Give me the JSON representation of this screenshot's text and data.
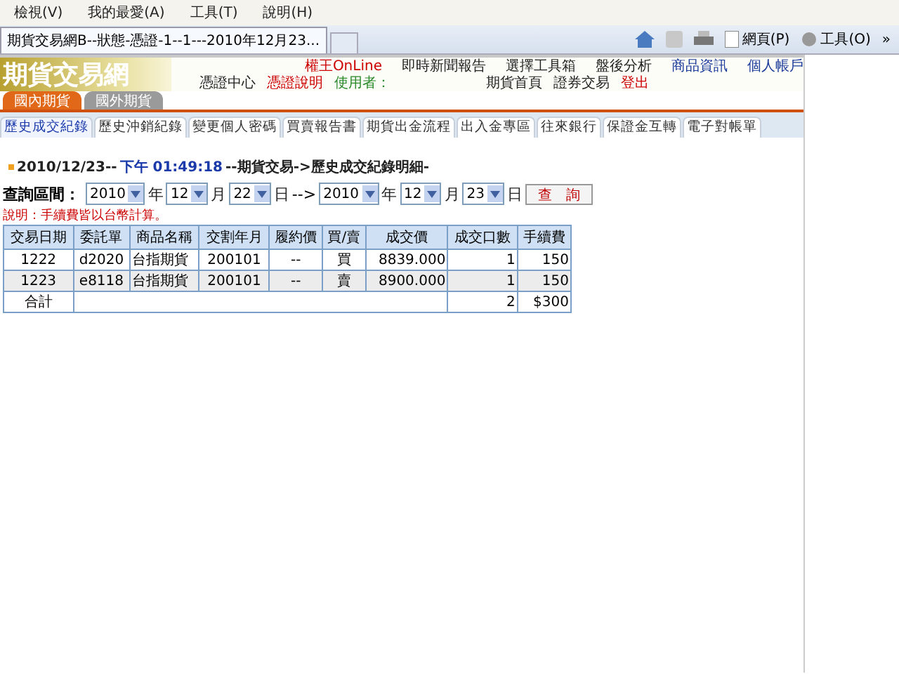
{
  "menu_bar": [
    "檢視(V)",
    "我的最愛(A)",
    "工具(T)",
    "說明(H)"
  ],
  "browser_tab": {
    "title": "期貨交易網B--狀態-憑證-1--1---2010年12月23..."
  },
  "toolbar": [
    {
      "kind": "home"
    },
    {
      "kind": "feed"
    },
    {
      "kind": "print"
    },
    {
      "kind": "page",
      "label": "網頁(P)"
    },
    {
      "kind": "tools",
      "label": "工具(O)"
    },
    {
      "kind": "more",
      "label": "»"
    }
  ],
  "site": {
    "logo": "期貨交易網",
    "nav_top": [
      {
        "label": "權王OnLine",
        "color": "#cc0000"
      },
      {
        "label": "即時新聞報告",
        "color": "#222222"
      },
      {
        "label": "選擇工具箱",
        "color": "#222222"
      },
      {
        "label": "盤後分析",
        "color": "#222222"
      },
      {
        "label": "商品資訊",
        "color": "#1a3a9a"
      },
      {
        "label": "個人帳戶",
        "color": "#1a3a9a"
      }
    ],
    "nav_bottom": [
      {
        "label": "憑證中心",
        "color": "#222222"
      },
      {
        "label": "憑證說明",
        "color": "#cc0000"
      },
      {
        "label": "使用者：",
        "color": "#2a8a2a"
      },
      {
        "label": "期貨首頁",
        "color": "#222222"
      },
      {
        "label": "證券交易",
        "color": "#222222"
      },
      {
        "label": "登出",
        "color": "#cc0000"
      }
    ]
  },
  "market_tabs": [
    {
      "label": "國內期貨",
      "selected": true
    },
    {
      "label": "國外期貨",
      "selected": false
    }
  ],
  "sub_tabs": [
    {
      "label": "歷史成交紀錄",
      "selected": true
    },
    {
      "label": "歷史沖銷紀錄",
      "selected": false
    },
    {
      "label": "變更個人密碼",
      "selected": false
    },
    {
      "label": "買賣報告書",
      "selected": false
    },
    {
      "label": "期貨出金流程",
      "selected": false
    },
    {
      "label": "出入金專區",
      "selected": false
    },
    {
      "label": "往來銀行",
      "selected": false
    },
    {
      "label": "保證金互轉",
      "selected": false
    },
    {
      "label": "電子對帳單",
      "selected": false
    }
  ],
  "breadcrumb": {
    "date": "2010/12/23--",
    "time": "下午 01:49:18",
    "path": "--期貨交易->歷史成交紀錄明細-"
  },
  "query": {
    "label": "查詢區間：",
    "from": {
      "year": "2010",
      "year_unit": "年",
      "month": "12",
      "month_unit": "月",
      "day": "22",
      "day_unit": "日"
    },
    "arrow": "-->",
    "to": {
      "year": "2010",
      "year_unit": "年",
      "month": "12",
      "month_unit": "月",
      "day": "23",
      "day_unit": "日"
    },
    "button": "查　詢"
  },
  "note": "說明：手續費皆以台幣計算。",
  "table": {
    "columns": [
      "交易日期",
      "委託單",
      "商品名稱",
      "交割年月",
      "履約價",
      "買/賣",
      "成交價",
      "成交口數",
      "手續費"
    ],
    "rows": [
      [
        "1222",
        "d2020",
        "台指期貨",
        "200101",
        "--",
        "買",
        "8839.000",
        "1",
        "150"
      ],
      [
        "1223",
        "e8118",
        "台指期貨",
        "200101",
        "--",
        "賣",
        "8900.000",
        "1",
        "150"
      ]
    ],
    "total": {
      "label": "合計",
      "lots": "2",
      "fee": "$300"
    }
  }
}
